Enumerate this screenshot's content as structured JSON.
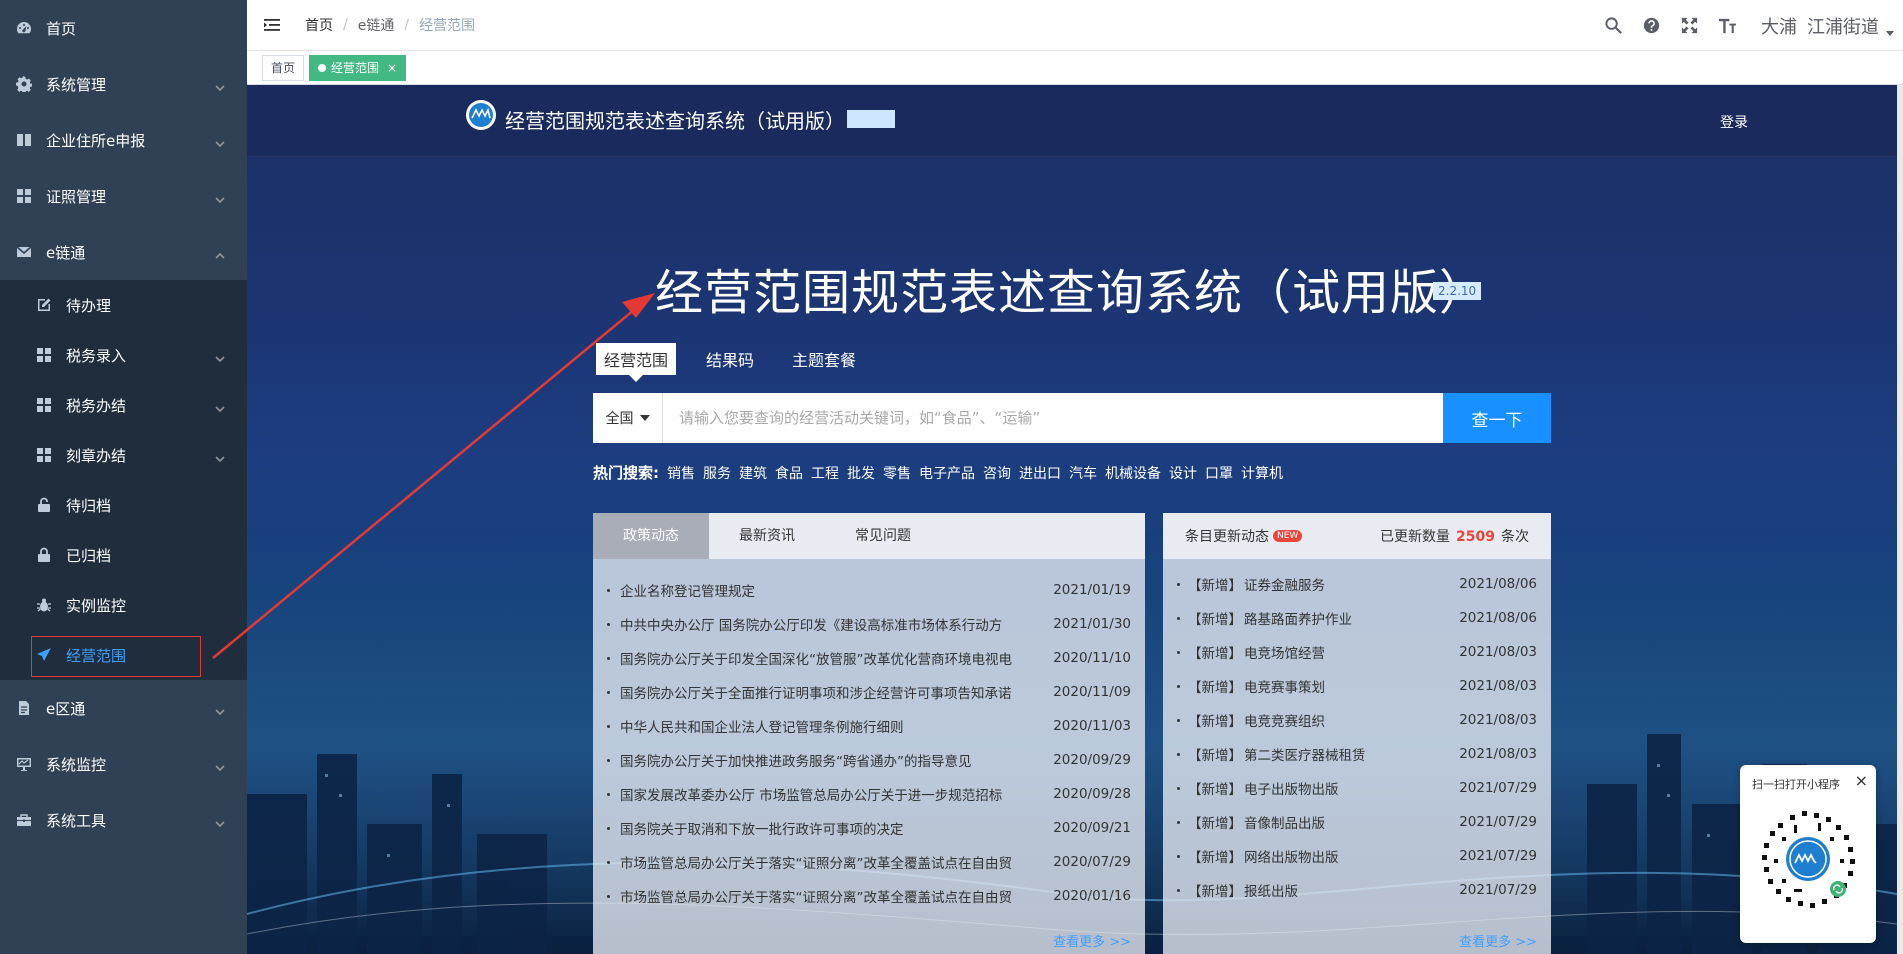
{
  "sidebar": {
    "items": [
      {
        "label": "首页",
        "icon": "dashboard-icon"
      },
      {
        "label": "系统管理",
        "icon": "gear-icon"
      },
      {
        "label": "企业住所e申报",
        "icon": "book-icon"
      },
      {
        "label": "证照管理",
        "icon": "grid-icon"
      },
      {
        "label": "e链通",
        "icon": "mail-icon"
      }
    ],
    "submenu": [
      {
        "label": "待办理",
        "icon": "edit-icon"
      },
      {
        "label": "税务录入",
        "icon": "grid-icon"
      },
      {
        "label": "税务办结",
        "icon": "grid-icon"
      },
      {
        "label": "刻章办结",
        "icon": "grid-icon"
      },
      {
        "label": "待归档",
        "icon": "unlock-icon"
      },
      {
        "label": "已归档",
        "icon": "lock-icon"
      },
      {
        "label": "实例监控",
        "icon": "bug-icon"
      },
      {
        "label": "经营范围",
        "icon": "send-icon"
      }
    ],
    "bottom_items": [
      {
        "label": "e区通",
        "icon": "document-icon"
      },
      {
        "label": "系统监控",
        "icon": "monitor-icon"
      },
      {
        "label": "系统工具",
        "icon": "toolbox-icon"
      }
    ]
  },
  "navbar": {
    "breadcrumb": [
      "首页",
      "e链通",
      "经营范围"
    ],
    "user": {
      "name": "大浦",
      "org": "江浦街道"
    }
  },
  "tags": [
    {
      "label": "首页"
    },
    {
      "label": "经营范围"
    }
  ],
  "embedded": {
    "header_title": "经营范围规范表述查询系统（试用版）",
    "login": "登录",
    "hero_title": "经营范围规范表述查询系统（试用版）",
    "version": "2.2.10",
    "tabs": [
      "经营范围",
      "结果码",
      "主题套餐"
    ],
    "search": {
      "region": "全国",
      "placeholder": "请输入您要查询的经营活动关键词，如“食品”、“运输”",
      "button": "查一下"
    },
    "hot": {
      "label": "热门搜索:",
      "items": [
        "销售",
        "服务",
        "建筑",
        "食品",
        "工程",
        "批发",
        "零售",
        "电子产品",
        "咨询",
        "进出口",
        "汽车",
        "机械设备",
        "设计",
        "口罩",
        "计算机"
      ]
    },
    "news": {
      "tabs": [
        "政策动态",
        "最新资讯",
        "常见问题"
      ],
      "items": [
        {
          "title": "企业名称登记管理规定",
          "date": "2021/01/19"
        },
        {
          "title": "中共中央办公厅 国务院办公厅印发《建设高标准市场体系行动方",
          "date": "2021/01/30"
        },
        {
          "title": "国务院办公厅关于印发全国深化“放管服”改革优化营商环境电视电",
          "date": "2020/11/10"
        },
        {
          "title": "国务院办公厅关于全面推行证明事项和涉企经营许可事项告知承诺",
          "date": "2020/11/09"
        },
        {
          "title": "中华人民共和国企业法人登记管理条例施行细则",
          "date": "2020/11/03"
        },
        {
          "title": "国务院办公厅关于加快推进政务服务“跨省通办”的指导意见",
          "date": "2020/09/29"
        },
        {
          "title": "国家发展改革委办公厅 市场监管总局办公厅关于进一步规范招标",
          "date": "2020/09/28"
        },
        {
          "title": "国务院关于取消和下放一批行政许可事项的决定",
          "date": "2020/09/21"
        },
        {
          "title": "市场监管总局办公厅关于落实“证照分离”改革全覆盖试点在自由贸",
          "date": "2020/07/29"
        },
        {
          "title": "市场监管总局办公厅关于落实“证照分离”改革全覆盖试点在自由贸",
          "date": "2020/01/16"
        }
      ],
      "more": "查看更多 >>"
    },
    "updates": {
      "title": "条目更新动态",
      "new_badge": "NEW",
      "count_label": "已更新数量",
      "count": "2509",
      "count_unit": "条次",
      "items": [
        {
          "tag": "【新增】",
          "name": "证券金融服务",
          "date": "2021/08/06"
        },
        {
          "tag": "【新增】",
          "name": "路基路面养护作业",
          "date": "2021/08/06"
        },
        {
          "tag": "【新增】",
          "name": "电竞场馆经营",
          "date": "2021/08/03"
        },
        {
          "tag": "【新增】",
          "name": "电竞赛事策划",
          "date": "2021/08/03"
        },
        {
          "tag": "【新增】",
          "name": "电竞竞赛组织",
          "date": "2021/08/03"
        },
        {
          "tag": "【新增】",
          "name": "第二类医疗器械租赁",
          "date": "2021/08/03"
        },
        {
          "tag": "【新增】",
          "name": "电子出版物出版",
          "date": "2021/07/29"
        },
        {
          "tag": "【新增】",
          "name": "音像制品出版",
          "date": "2021/07/29"
        },
        {
          "tag": "【新增】",
          "name": "网络出版物出版",
          "date": "2021/07/29"
        },
        {
          "tag": "【新增】",
          "name": "报纸出版",
          "date": "2021/07/29"
        }
      ],
      "more": "查看更多 >>"
    },
    "miniprogram": {
      "text": "扫一扫打开小程序",
      "close": "×"
    }
  },
  "colors": {
    "sidebar_bg": "#304156",
    "submenu_bg": "#1f2d3d",
    "accent": "#409eff",
    "tag_active": "#42b983",
    "annotation_red": "#e03a3a",
    "search_button": "#1890ff"
  }
}
